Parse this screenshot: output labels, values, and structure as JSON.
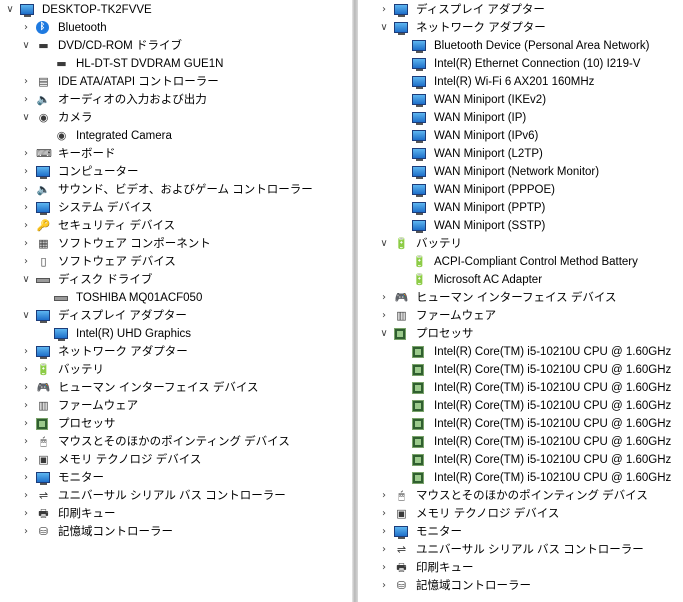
{
  "left": {
    "root": "DESKTOP-TK2FVVE",
    "rows": [
      {
        "label": "Bluetooth",
        "level": 1,
        "exp": "closed",
        "icon": "bluetooth-icon",
        "glyph": "ᛒ",
        "cls": "i-bt"
      },
      {
        "label": "DVD/CD-ROM ドライブ",
        "level": 1,
        "exp": "open",
        "icon": "dvd-drive-icon",
        "glyph": "▬",
        "cls": "i-generic"
      },
      {
        "label": "HL-DT-ST DVDRAM GUE1N",
        "level": 2,
        "exp": "none",
        "icon": "dvd-drive-icon",
        "glyph": "▬",
        "cls": "i-generic"
      },
      {
        "label": "IDE ATA/ATAPI コントローラー",
        "level": 1,
        "exp": "closed",
        "icon": "ide-controller-icon",
        "glyph": "▤",
        "cls": "i-generic"
      },
      {
        "label": "オーディオの入力および出力",
        "level": 1,
        "exp": "closed",
        "icon": "speaker-icon",
        "glyph": "🔈",
        "cls": "i-generic"
      },
      {
        "label": "カメラ",
        "level": 1,
        "exp": "open",
        "icon": "camera-icon",
        "glyph": "◉",
        "cls": "i-generic"
      },
      {
        "label": "Integrated Camera",
        "level": 2,
        "exp": "none",
        "icon": "camera-icon",
        "glyph": "◉",
        "cls": "i-generic"
      },
      {
        "label": "キーボード",
        "level": 1,
        "exp": "closed",
        "icon": "keyboard-icon",
        "glyph": "⌨",
        "cls": "i-generic"
      },
      {
        "label": "コンピューター",
        "level": 1,
        "exp": "closed",
        "icon": "computer-icon",
        "glyph": "",
        "cls": "i-monitor"
      },
      {
        "label": "サウンド、ビデオ、およびゲーム コントローラー",
        "level": 1,
        "exp": "closed",
        "icon": "speaker-icon",
        "glyph": "🔈",
        "cls": "i-generic"
      },
      {
        "label": "システム デバイス",
        "level": 1,
        "exp": "closed",
        "icon": "system-device-icon",
        "glyph": "",
        "cls": "i-monitor"
      },
      {
        "label": "セキュリティ デバイス",
        "level": 1,
        "exp": "closed",
        "icon": "security-device-icon",
        "glyph": "🔑",
        "cls": "i-generic"
      },
      {
        "label": "ソフトウェア コンポーネント",
        "level": 1,
        "exp": "closed",
        "icon": "software-component-icon",
        "glyph": "▦",
        "cls": "i-generic"
      },
      {
        "label": "ソフトウェア デバイス",
        "level": 1,
        "exp": "closed",
        "icon": "software-device-icon",
        "glyph": "▯",
        "cls": "i-generic"
      },
      {
        "label": "ディスク ドライブ",
        "level": 1,
        "exp": "open",
        "icon": "disk-drive-icon",
        "glyph": "",
        "cls": "i-disk"
      },
      {
        "label": "TOSHIBA MQ01ACF050",
        "level": 2,
        "exp": "none",
        "icon": "disk-drive-icon",
        "glyph": "",
        "cls": "i-disk"
      },
      {
        "label": "ディスプレイ アダプター",
        "level": 1,
        "exp": "open",
        "icon": "display-adapter-icon",
        "glyph": "",
        "cls": "i-monitor"
      },
      {
        "label": "Intel(R) UHD Graphics",
        "level": 2,
        "exp": "none",
        "icon": "display-adapter-icon",
        "glyph": "",
        "cls": "i-monitor"
      },
      {
        "label": "ネットワーク アダプター",
        "level": 1,
        "exp": "closed",
        "icon": "network-adapter-icon",
        "glyph": "",
        "cls": "i-monitor"
      },
      {
        "label": "バッテリ",
        "level": 1,
        "exp": "closed",
        "icon": "battery-icon",
        "glyph": "🔋",
        "cls": "i-generic"
      },
      {
        "label": "ヒューマン インターフェイス デバイス",
        "level": 1,
        "exp": "closed",
        "icon": "hid-icon",
        "glyph": "🎮",
        "cls": "i-generic"
      },
      {
        "label": "ファームウェア",
        "level": 1,
        "exp": "closed",
        "icon": "firmware-icon",
        "glyph": "▥",
        "cls": "i-generic"
      },
      {
        "label": "プロセッサ",
        "level": 1,
        "exp": "closed",
        "icon": "processor-icon",
        "glyph": "",
        "cls": "i-chip"
      },
      {
        "label": "マウスとそのほかのポインティング デバイス",
        "level": 1,
        "exp": "closed",
        "icon": "mouse-icon",
        "glyph": "🖱",
        "cls": "i-generic"
      },
      {
        "label": "メモリ テクノロジ デバイス",
        "level": 1,
        "exp": "closed",
        "icon": "memory-device-icon",
        "glyph": "▣",
        "cls": "i-generic"
      },
      {
        "label": "モニター",
        "level": 1,
        "exp": "closed",
        "icon": "monitor-icon",
        "glyph": "",
        "cls": "i-monitor"
      },
      {
        "label": "ユニバーサル シリアル バス コントローラー",
        "level": 1,
        "exp": "closed",
        "icon": "usb-icon",
        "glyph": "⇌",
        "cls": "i-generic"
      },
      {
        "label": "印刷キュー",
        "level": 1,
        "exp": "closed",
        "icon": "printer-icon",
        "glyph": "🖶",
        "cls": "i-generic"
      },
      {
        "label": "記憶域コントローラー",
        "level": 1,
        "exp": "closed",
        "icon": "storage-controller-icon",
        "glyph": "⛁",
        "cls": "i-generic"
      }
    ]
  },
  "right": {
    "rows": [
      {
        "label": "ディスプレイ アダプター",
        "level": 1,
        "exp": "closed",
        "icon": "display-adapter-icon",
        "glyph": "",
        "cls": "i-monitor"
      },
      {
        "label": "ネットワーク アダプター",
        "level": 1,
        "exp": "open",
        "icon": "network-adapter-icon",
        "glyph": "",
        "cls": "i-monitor"
      },
      {
        "label": "Bluetooth Device (Personal Area Network)",
        "level": 2,
        "exp": "none",
        "icon": "network-adapter-icon",
        "glyph": "",
        "cls": "i-monitor"
      },
      {
        "label": "Intel(R) Ethernet Connection (10) I219-V",
        "level": 2,
        "exp": "none",
        "icon": "network-adapter-icon",
        "glyph": "",
        "cls": "i-monitor"
      },
      {
        "label": "Intel(R) Wi-Fi 6 AX201 160MHz",
        "level": 2,
        "exp": "none",
        "icon": "network-adapter-icon",
        "glyph": "",
        "cls": "i-monitor"
      },
      {
        "label": "WAN Miniport (IKEv2)",
        "level": 2,
        "exp": "none",
        "icon": "network-adapter-icon",
        "glyph": "",
        "cls": "i-monitor"
      },
      {
        "label": "WAN Miniport (IP)",
        "level": 2,
        "exp": "none",
        "icon": "network-adapter-icon",
        "glyph": "",
        "cls": "i-monitor"
      },
      {
        "label": "WAN Miniport (IPv6)",
        "level": 2,
        "exp": "none",
        "icon": "network-adapter-icon",
        "glyph": "",
        "cls": "i-monitor"
      },
      {
        "label": "WAN Miniport (L2TP)",
        "level": 2,
        "exp": "none",
        "icon": "network-adapter-icon",
        "glyph": "",
        "cls": "i-monitor"
      },
      {
        "label": "WAN Miniport (Network Monitor)",
        "level": 2,
        "exp": "none",
        "icon": "network-adapter-icon",
        "glyph": "",
        "cls": "i-monitor"
      },
      {
        "label": "WAN Miniport (PPPOE)",
        "level": 2,
        "exp": "none",
        "icon": "network-adapter-icon",
        "glyph": "",
        "cls": "i-monitor"
      },
      {
        "label": "WAN Miniport (PPTP)",
        "level": 2,
        "exp": "none",
        "icon": "network-adapter-icon",
        "glyph": "",
        "cls": "i-monitor"
      },
      {
        "label": "WAN Miniport (SSTP)",
        "level": 2,
        "exp": "none",
        "icon": "network-adapter-icon",
        "glyph": "",
        "cls": "i-monitor"
      },
      {
        "label": "バッテリ",
        "level": 1,
        "exp": "open",
        "icon": "battery-icon",
        "glyph": "🔋",
        "cls": "i-generic"
      },
      {
        "label": "ACPI-Compliant Control Method Battery",
        "level": 2,
        "exp": "none",
        "icon": "battery-icon",
        "glyph": "🔋",
        "cls": "i-generic"
      },
      {
        "label": "Microsoft AC Adapter",
        "level": 2,
        "exp": "none",
        "icon": "battery-icon",
        "glyph": "🔋",
        "cls": "i-generic"
      },
      {
        "label": "ヒューマン インターフェイス デバイス",
        "level": 1,
        "exp": "closed",
        "icon": "hid-icon",
        "glyph": "🎮",
        "cls": "i-generic"
      },
      {
        "label": "ファームウェア",
        "level": 1,
        "exp": "closed",
        "icon": "firmware-icon",
        "glyph": "▥",
        "cls": "i-generic"
      },
      {
        "label": "プロセッサ",
        "level": 1,
        "exp": "open",
        "icon": "processor-icon",
        "glyph": "",
        "cls": "i-chip"
      },
      {
        "label": "Intel(R) Core(TM) i5-10210U CPU @ 1.60GHz",
        "level": 2,
        "exp": "none",
        "icon": "processor-icon",
        "glyph": "",
        "cls": "i-chip"
      },
      {
        "label": "Intel(R) Core(TM) i5-10210U CPU @ 1.60GHz",
        "level": 2,
        "exp": "none",
        "icon": "processor-icon",
        "glyph": "",
        "cls": "i-chip"
      },
      {
        "label": "Intel(R) Core(TM) i5-10210U CPU @ 1.60GHz",
        "level": 2,
        "exp": "none",
        "icon": "processor-icon",
        "glyph": "",
        "cls": "i-chip"
      },
      {
        "label": "Intel(R) Core(TM) i5-10210U CPU @ 1.60GHz",
        "level": 2,
        "exp": "none",
        "icon": "processor-icon",
        "glyph": "",
        "cls": "i-chip"
      },
      {
        "label": "Intel(R) Core(TM) i5-10210U CPU @ 1.60GHz",
        "level": 2,
        "exp": "none",
        "icon": "processor-icon",
        "glyph": "",
        "cls": "i-chip"
      },
      {
        "label": "Intel(R) Core(TM) i5-10210U CPU @ 1.60GHz",
        "level": 2,
        "exp": "none",
        "icon": "processor-icon",
        "glyph": "",
        "cls": "i-chip"
      },
      {
        "label": "Intel(R) Core(TM) i5-10210U CPU @ 1.60GHz",
        "level": 2,
        "exp": "none",
        "icon": "processor-icon",
        "glyph": "",
        "cls": "i-chip"
      },
      {
        "label": "Intel(R) Core(TM) i5-10210U CPU @ 1.60GHz",
        "level": 2,
        "exp": "none",
        "icon": "processor-icon",
        "glyph": "",
        "cls": "i-chip"
      },
      {
        "label": "マウスとそのほかのポインティング デバイス",
        "level": 1,
        "exp": "closed",
        "icon": "mouse-icon",
        "glyph": "🖱",
        "cls": "i-generic"
      },
      {
        "label": "メモリ テクノロジ デバイス",
        "level": 1,
        "exp": "closed",
        "icon": "memory-device-icon",
        "glyph": "▣",
        "cls": "i-generic"
      },
      {
        "label": "モニター",
        "level": 1,
        "exp": "closed",
        "icon": "monitor-icon",
        "glyph": "",
        "cls": "i-monitor"
      },
      {
        "label": "ユニバーサル シリアル バス コントローラー",
        "level": 1,
        "exp": "closed",
        "icon": "usb-icon",
        "glyph": "⇌",
        "cls": "i-generic"
      },
      {
        "label": "印刷キュー",
        "level": 1,
        "exp": "closed",
        "icon": "printer-icon",
        "glyph": "🖶",
        "cls": "i-generic"
      },
      {
        "label": "記憶域コントローラー",
        "level": 1,
        "exp": "closed",
        "icon": "storage-controller-icon",
        "glyph": "⛁",
        "cls": "i-generic"
      }
    ]
  }
}
